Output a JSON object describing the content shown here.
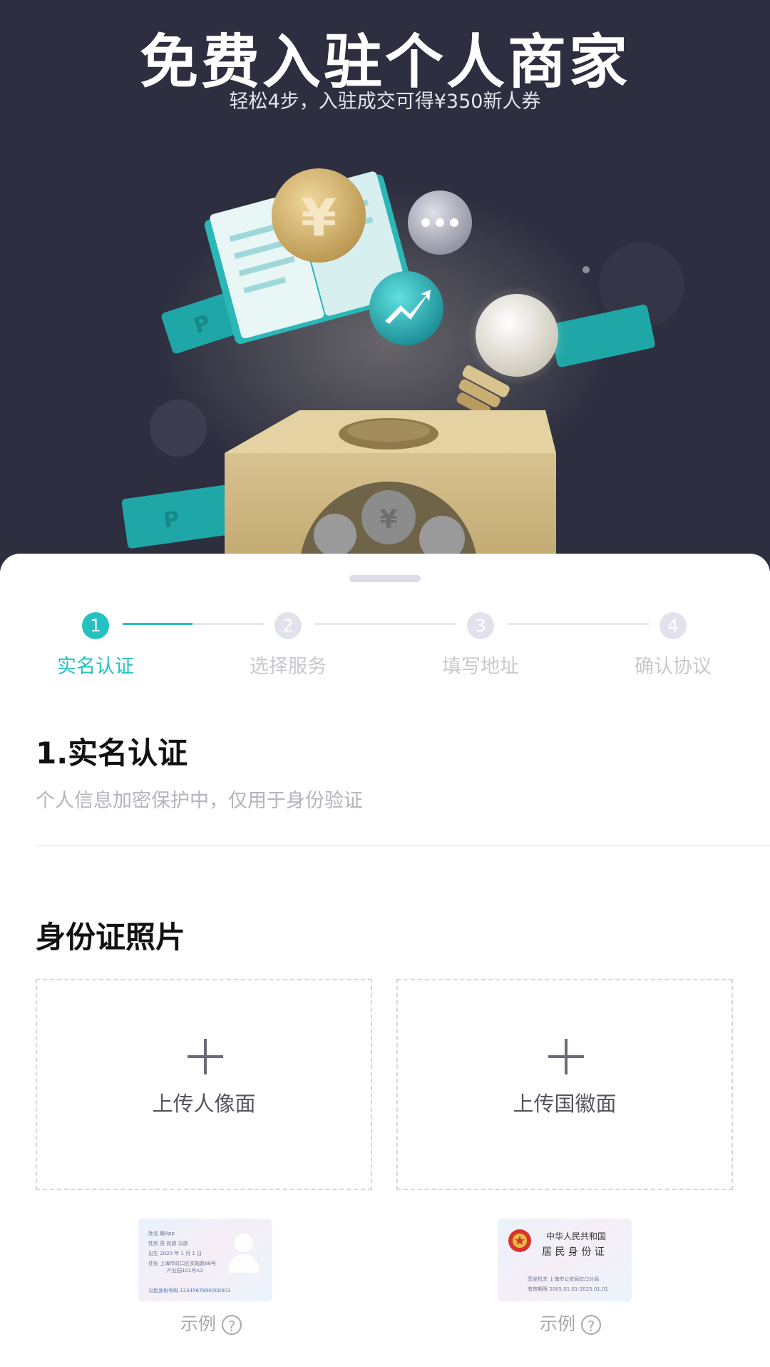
{
  "hero": {
    "title": "免费入驻个人商家",
    "subtitle": "轻松4步，入驻成交可得¥350新人券"
  },
  "steps": [
    {
      "number": "1",
      "label": "实名认证",
      "active": true
    },
    {
      "number": "2",
      "label": "选择服务",
      "active": false
    },
    {
      "number": "3",
      "label": "填写地址",
      "active": false
    },
    {
      "number": "4",
      "label": "确认协议",
      "active": false
    }
  ],
  "section": {
    "title": "1.实名认证",
    "subtitle": "个人信息加密保护中，仅用于身份验证"
  },
  "id_photos": {
    "title": "身份证照片",
    "front_label": "上传人像面",
    "back_label": "上传国徽面",
    "example_label": "示例",
    "help_glyph": "?"
  },
  "sample_front": {
    "name_line": "姓名 趣App",
    "gender_line": "性别 男  民族 汉族",
    "birth_line": "出生 2020 年 1 月 1 日",
    "address_line1": "住址 上海市虹口区实践路88号",
    "address_line2": "产业园101号A3",
    "id_line": "公民身份号码 1234567890000001"
  },
  "sample_back": {
    "country": "中华人民共和国",
    "card_name": "居 民 身 份 证",
    "authority": "签发机关 上海市公安局虹口分局",
    "validity": "有效期限 2005.01.01-2025.01.01"
  },
  "colors": {
    "accent": "#25c1c1",
    "hero_bg": "#2d2e3f",
    "inactive": "#e2e2ec"
  }
}
